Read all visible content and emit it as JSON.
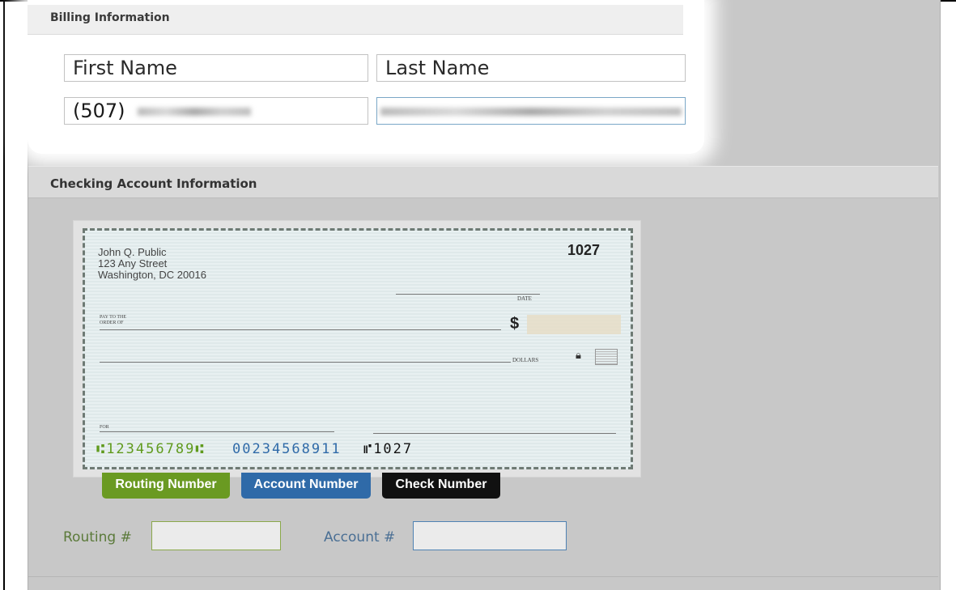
{
  "billing": {
    "title": "Billing Information",
    "first_name_placeholder": "First Name",
    "last_name_placeholder": "Last Name",
    "phone_value": "(507)"
  },
  "checking": {
    "title": "Checking Account Information",
    "check": {
      "name": "John Q. Public",
      "street": "123 Any Street",
      "city": "Washington, DC 20016",
      "number": "1027",
      "date_label": "DATE",
      "pay_to_label": "PAY TO THE ORDER OF",
      "dollar_sign": "$",
      "dollars_label": "DOLLARS",
      "for_label": "FOR",
      "micr_routing": "⑆123456789⑆",
      "micr_account": "00234568911",
      "micr_check": "⑈1027"
    },
    "tags": {
      "routing": "Routing Number",
      "account": "Account Number",
      "check": "Check Number"
    },
    "routing_label": "Routing #",
    "account_label": "Account #"
  },
  "colors": {
    "routing_green": "#6a9a22",
    "account_blue": "#2f6aa8",
    "check_black": "#111111",
    "label_green": "#5b7a3a"
  }
}
